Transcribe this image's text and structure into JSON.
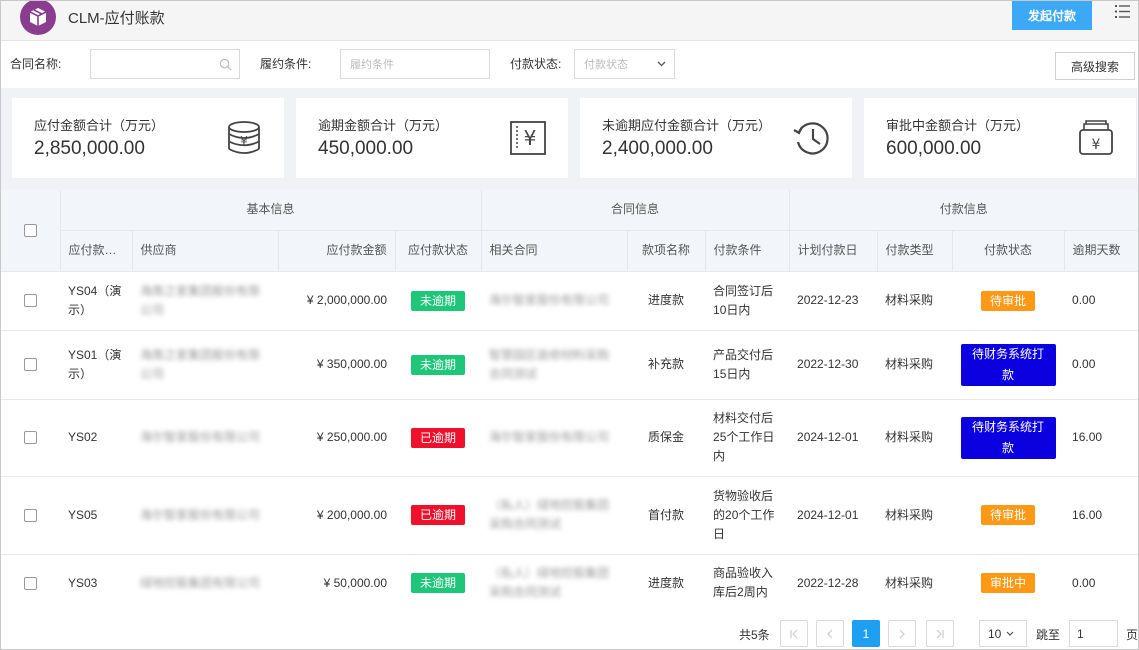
{
  "header": {
    "title": "CLM-应付账款",
    "primary_button": "发起付款",
    "logo_icon": "box-icon",
    "menu_icon": "list-menu-icon"
  },
  "filters": {
    "contract_label": "合同名称:",
    "contract_value": "",
    "performance_label": "履约条件:",
    "performance_placeholder": "履约条件",
    "pay_status_label": "付款状态:",
    "pay_status_placeholder": "付款状态",
    "advanced_search": "高级搜索"
  },
  "summary": [
    {
      "label": "应付金额合计（万元）",
      "value": "2,850,000.00",
      "icon": "coins-icon"
    },
    {
      "label": "逾期金额合计（万元）",
      "value": "450,000.00",
      "icon": "bill-yen-icon"
    },
    {
      "label": "未逾期应付金额合计（万元）",
      "value": "2,400,000.00",
      "icon": "history-clock-icon"
    },
    {
      "label": "审批中金额合计（万元）",
      "value": "600,000.00",
      "icon": "wallet-yen-icon"
    }
  ],
  "table": {
    "groups": [
      "基本信息",
      "合同信息",
      "付款信息"
    ],
    "columns": [
      "应付款…",
      "供应商",
      "应付款金额",
      "应付款状态",
      "相关合同",
      "款项名称",
      "付款条件",
      "计划付款日",
      "付款类型",
      "付款状态",
      "逾期天数"
    ],
    "rows": [
      {
        "id": "YS04（演示）",
        "supplier": "海南之家集团股份有限公司",
        "amount": "¥ 2,000,000.00",
        "status": "未逾期",
        "status_color": "#1ec67a",
        "contract": "海尔智家股份有限公司",
        "item": "进度款",
        "condition": "合同签订后10日内",
        "date": "2022-12-23",
        "type": "材料采购",
        "pay_status": "待审批",
        "pay_status_color": "#ff9814",
        "overdue": "0.00"
      },
      {
        "id": "YS01（演示）",
        "supplier": "海南之家集团股份有限公司",
        "amount": "¥ 350,000.00",
        "status": "未逾期",
        "status_color": "#1ec67a",
        "contract": "智慧园区装修材料采购合同测试",
        "item": "补充款",
        "condition": "产品交付后15日内",
        "date": "2022-12-30",
        "type": "材料采购",
        "pay_status": "待财务系统打款",
        "pay_status_color": "#0b00e0",
        "overdue": "0.00"
      },
      {
        "id": "YS02",
        "supplier": "海尔智家股份有限公司",
        "amount": "¥ 250,000.00",
        "status": "已逾期",
        "status_color": "#f0102c",
        "contract": "海尔智家股份有限公司",
        "item": "质保金",
        "condition": "材料交付后25个工作日内",
        "date": "2024-12-01",
        "type": "材料采购",
        "pay_status": "待财务系统打款",
        "pay_status_color": "#0b00e0",
        "overdue": "16.00"
      },
      {
        "id": "YS05",
        "supplier": "海尔智家股份有限公司",
        "amount": "¥ 200,000.00",
        "status": "已逾期",
        "status_color": "#f0102c",
        "contract": "（私人）绿地控股集团采购合同测试",
        "item": "首付款",
        "condition": "货物验收后的20个工作日",
        "date": "2024-12-01",
        "type": "材料采购",
        "pay_status": "待审批",
        "pay_status_color": "#ff9814",
        "overdue": "16.00"
      },
      {
        "id": "YS03",
        "supplier": "绿地控股集团有限公司",
        "amount": "¥ 50,000.00",
        "status": "未逾期",
        "status_color": "#1ec67a",
        "contract": "（私人）绿地控股集团采购合同测试",
        "item": "进度款",
        "condition": "商品验收入库后2周内",
        "date": "2022-12-28",
        "type": "材料采购",
        "pay_status": "审批中",
        "pay_status_color": "#ff9814",
        "overdue": "0.00"
      }
    ]
  },
  "pagination": {
    "total": "共5条",
    "current_page": "1",
    "page_size": "10",
    "jump_label": "跳至",
    "jump_value": "1",
    "page_suffix": "页"
  }
}
